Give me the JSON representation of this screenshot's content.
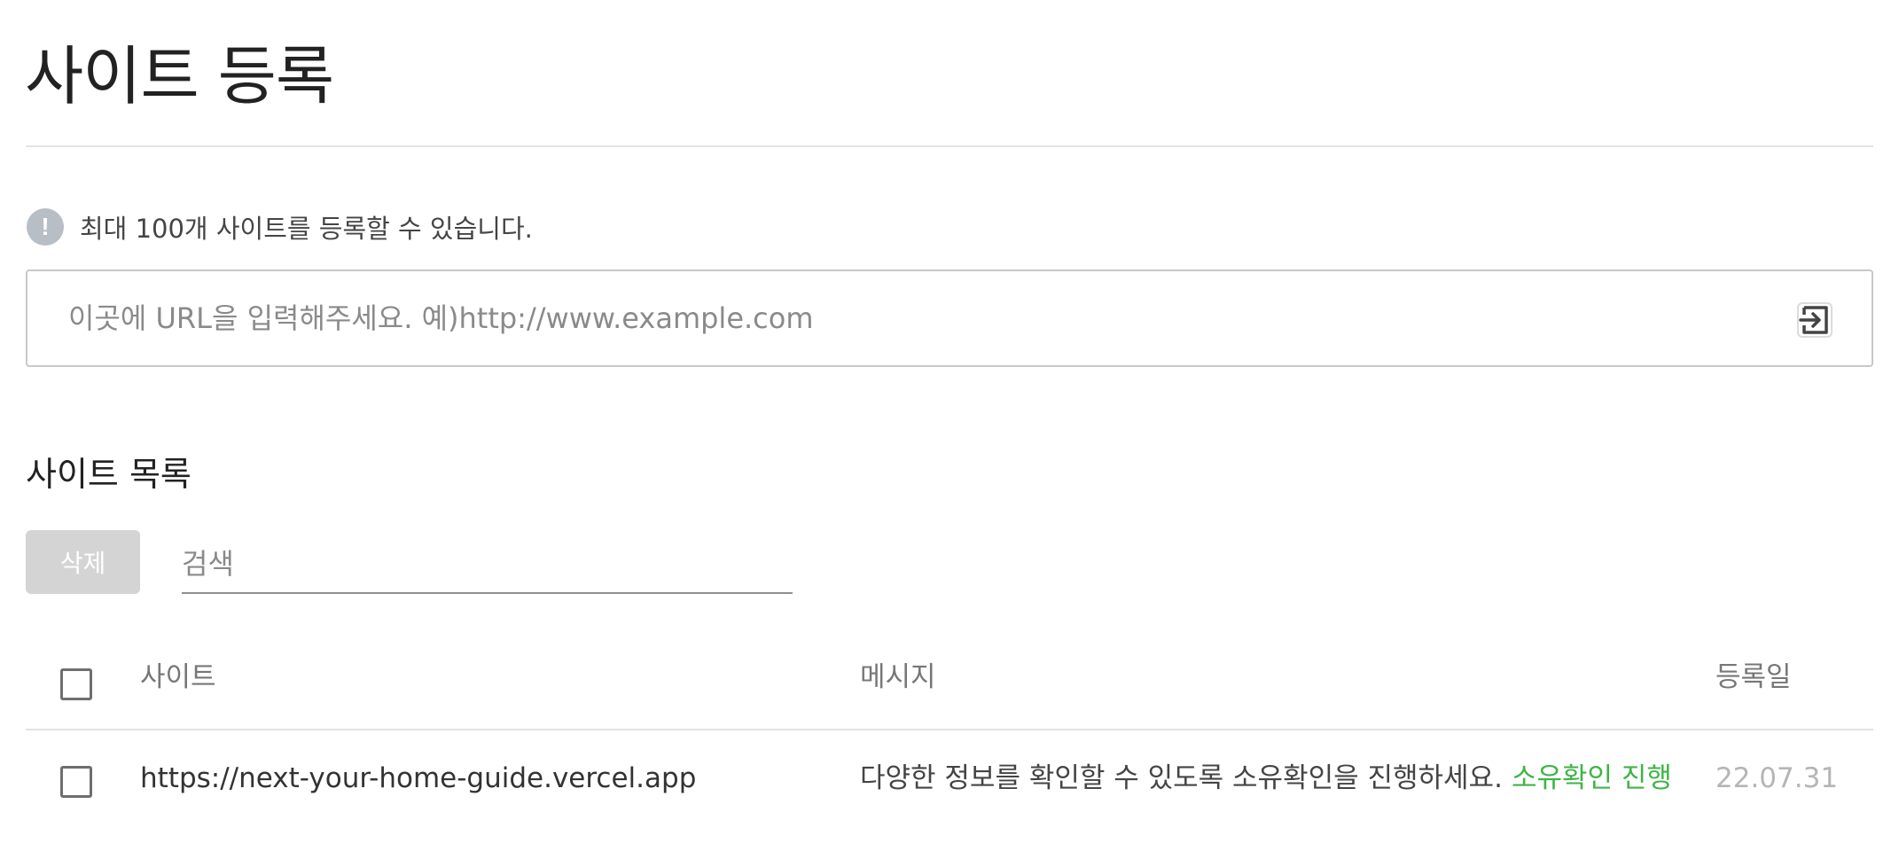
{
  "page": {
    "title": "사이트 등록"
  },
  "notice": {
    "icon": "exclamation-icon",
    "text": "최대 100개 사이트를 등록할 수 있습니다."
  },
  "url_input": {
    "value": "",
    "placeholder": "이곳에 URL을 입력해주세요. 예)http://www.example.com",
    "submit_icon": "enter-arrow-icon"
  },
  "site_list": {
    "title": "사이트 목록",
    "delete_label": "삭제",
    "search": {
      "value": "",
      "placeholder": "검색"
    },
    "columns": {
      "site": "사이트",
      "message": "메시지",
      "registered": "등록일"
    },
    "rows": [
      {
        "checked": false,
        "site": "https://next-your-home-guide.vercel.app",
        "message": "다양한 정보를 확인할 수 있도록 소유확인을 진행하세요.",
        "action": "소유확인 진행",
        "date": "22.07.31"
      }
    ]
  },
  "colors": {
    "accent_green": "#3fb447",
    "disabled_button": "#d4d4d4",
    "notice_icon": "#b7bec6"
  }
}
